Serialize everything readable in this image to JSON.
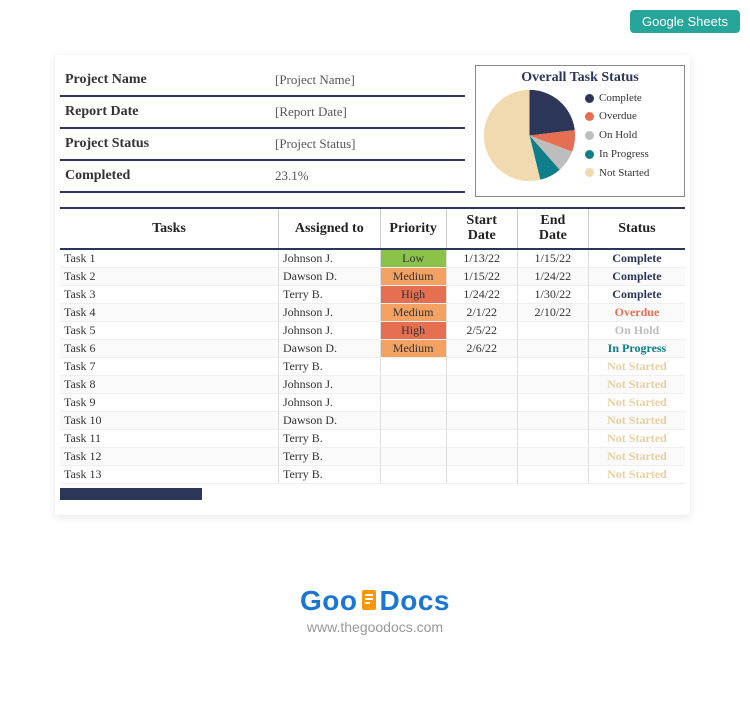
{
  "badge": "Google Sheets",
  "meta": {
    "rows": [
      {
        "label": "Project Name",
        "value": "[Project Name]"
      },
      {
        "label": "Report Date",
        "value": "[Report Date]"
      },
      {
        "label": "Project Status",
        "value": "[Project Status]"
      },
      {
        "label": "Completed",
        "value": "23.1%"
      }
    ]
  },
  "chart_title": "Overall Task Status",
  "chart_data": {
    "type": "pie",
    "title": "Overall Task Status",
    "series": [
      {
        "name": "Complete",
        "value": 23.1,
        "color": "#2c3659"
      },
      {
        "name": "Overdue",
        "value": 7.7,
        "color": "#e76f51"
      },
      {
        "name": "On Hold",
        "value": 7.7,
        "color": "#bdbdbd"
      },
      {
        "name": "In Progress",
        "value": 7.7,
        "color": "#0d7e8a"
      },
      {
        "name": "Not Started",
        "value": 53.8,
        "color": "#f1d9b0"
      }
    ]
  },
  "columns": {
    "tasks": "Tasks",
    "assigned": "Assigned to",
    "priority": "Priority",
    "start": "Start Date",
    "end": "End Date",
    "status": "Status"
  },
  "status_colors": {
    "Complete": "#2c3659",
    "Overdue": "#e76f51",
    "On Hold": "#bdbdbd",
    "In Progress": "#0d7e8a",
    "Not Started": "#e8cfa0"
  },
  "priority_classes": {
    "Low": "prio-low",
    "Medium": "prio-med",
    "High": "prio-high"
  },
  "tasks": [
    {
      "task": "Task 1",
      "assigned": "Johnson J.",
      "priority": "Low",
      "start": "1/13/22",
      "end": "1/15/22",
      "status": "Complete"
    },
    {
      "task": "Task 2",
      "assigned": "Dawson D.",
      "priority": "Medium",
      "start": "1/15/22",
      "end": "1/24/22",
      "status": "Complete"
    },
    {
      "task": "Task 3",
      "assigned": "Terry B.",
      "priority": "High",
      "start": "1/24/22",
      "end": "1/30/22",
      "status": "Complete"
    },
    {
      "task": "Task 4",
      "assigned": "Johnson J.",
      "priority": "Medium",
      "start": "2/1/22",
      "end": "2/10/22",
      "status": "Overdue"
    },
    {
      "task": "Task 5",
      "assigned": "Johnson J.",
      "priority": "High",
      "start": "2/5/22",
      "end": "",
      "status": "On Hold"
    },
    {
      "task": "Task 6",
      "assigned": "Dawson D.",
      "priority": "Medium",
      "start": "2/6/22",
      "end": "",
      "status": "In Progress"
    },
    {
      "task": "Task 7",
      "assigned": "Terry B.",
      "priority": "",
      "start": "",
      "end": "",
      "status": "Not Started"
    },
    {
      "task": "Task 8",
      "assigned": "Johnson J.",
      "priority": "",
      "start": "",
      "end": "",
      "status": "Not Started"
    },
    {
      "task": "Task 9",
      "assigned": "Johnson J.",
      "priority": "",
      "start": "",
      "end": "",
      "status": "Not Started"
    },
    {
      "task": "Task 10",
      "assigned": "Dawson D.",
      "priority": "",
      "start": "",
      "end": "",
      "status": "Not Started"
    },
    {
      "task": "Task 11",
      "assigned": "Terry B.",
      "priority": "",
      "start": "",
      "end": "",
      "status": "Not Started"
    },
    {
      "task": "Task 12",
      "assigned": "Terry B.",
      "priority": "",
      "start": "",
      "end": "",
      "status": "Not Started"
    },
    {
      "task": "Task 13",
      "assigned": "Terry B.",
      "priority": "",
      "start": "",
      "end": "",
      "status": "Not Started"
    }
  ],
  "footer": {
    "logo_part1": "Goo",
    "logo_part2": "Docs",
    "url": "www.thegoodocs.com"
  }
}
